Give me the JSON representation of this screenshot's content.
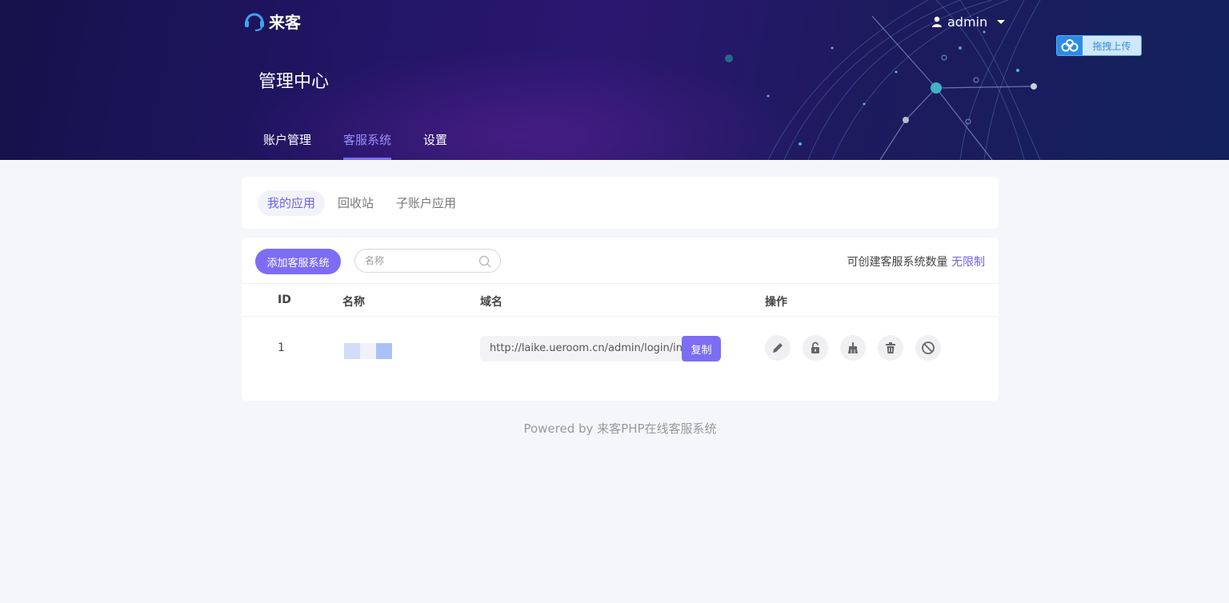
{
  "brand": {
    "name": "来客"
  },
  "user": {
    "name": "admin"
  },
  "upload": {
    "label": "拖拽上传"
  },
  "page": {
    "title": "管理中心"
  },
  "nav": {
    "items": [
      {
        "label": "账户管理"
      },
      {
        "label": "客服系统"
      },
      {
        "label": "设置"
      }
    ],
    "active": "客服系统"
  },
  "subtabs": {
    "items": [
      {
        "label": "我的应用"
      },
      {
        "label": "回收站"
      },
      {
        "label": "子账户应用"
      }
    ],
    "active": "我的应用"
  },
  "toolbar": {
    "add_label": "添加客服系统",
    "search_placeholder": "名称",
    "quota_label": "可创建客服系统数量",
    "quota_value": "无限制"
  },
  "table": {
    "headers": {
      "id": "ID",
      "name": "名称",
      "domain": "域名",
      "actions": "操作"
    },
    "rows": [
      {
        "id": "1",
        "domain": "http://laike.ueroom.cn/admin/login/index",
        "copy_label": "复制",
        "actions": [
          "edit-icon",
          "unlock-icon",
          "broom-icon",
          "trash-icon",
          "ban-icon"
        ]
      }
    ]
  },
  "footer": {
    "text": "Powered by 来客PHP在线客服系统"
  },
  "colors": {
    "accent": "#7b6ef4",
    "header_bg": "#1f1660",
    "active_nav": "#9a90ff"
  }
}
